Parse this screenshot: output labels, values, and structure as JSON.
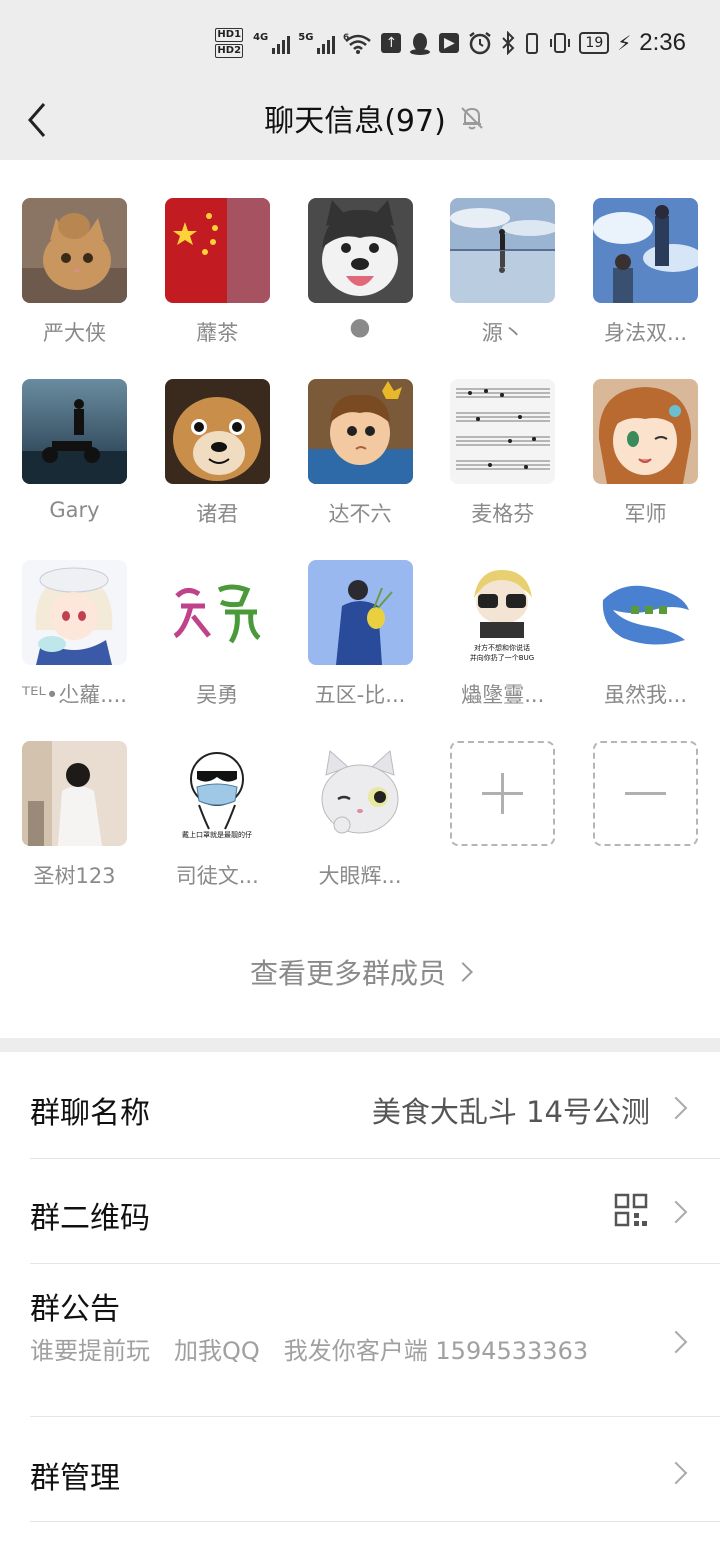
{
  "status_bar": {
    "hd1": "HD1",
    "hd2": "HD2",
    "network_4g": "4G",
    "network_5g": "5G",
    "wifi_tag": "6",
    "battery": "19",
    "time": "2:36",
    "icons": [
      "wifi-icon",
      "upload-icon",
      "qq-icon",
      "app-icon",
      "alarm-icon",
      "bluetooth-icon",
      "vibrate-icon",
      "battery-icon",
      "charging-icon"
    ]
  },
  "nav": {
    "title": "聊天信息(97)",
    "back_icon": "chevron-left-icon",
    "mute_icon": "bell-off-icon"
  },
  "members": [
    {
      "name": "严大侠",
      "avatar": "cat-photo"
    },
    {
      "name": "蘼茶",
      "avatar": "flag-photo"
    },
    {
      "name": "🌑",
      "avatar": "husky-photo"
    },
    {
      "name": "源丶",
      "avatar": "reflection-photo"
    },
    {
      "name": "身法双...",
      "avatar": "anime-sky"
    },
    {
      "name": "Gary",
      "avatar": "motorbike-photo"
    },
    {
      "name": "诸君",
      "avatar": "shiba-photo"
    },
    {
      "name": "达不六",
      "avatar": "cartoon-boy"
    },
    {
      "name": "麦格芬",
      "avatar": "sheet-music"
    },
    {
      "name": "军师",
      "avatar": "anime-girl"
    },
    {
      "name": "ᵀᴱᴸ•尐蘿....",
      "avatar": "anime-white-hair"
    },
    {
      "name": "吴勇",
      "avatar": "calligraphy"
    },
    {
      "name": "五区-比...",
      "avatar": "blue-robe"
    },
    {
      "name": "爞墬靊...",
      "avatar": "glasses-meme"
    },
    {
      "name": "虽然我...",
      "avatar": "blue-dragon"
    },
    {
      "name": "圣树123",
      "avatar": "man-back"
    },
    {
      "name": "司徒文...",
      "avatar": "mask-meme"
    },
    {
      "name": "大眼辉...",
      "avatar": "wink-cat"
    }
  ],
  "add_member_icon": "plus-icon",
  "remove_member_icon": "minus-icon",
  "more_members_label": "查看更多群成员",
  "settings": {
    "group_name": {
      "label": "群聊名称",
      "value": "美食大乱斗 14号公测"
    },
    "qr_code": {
      "label": "群二维码"
    },
    "notice": {
      "label": "群公告",
      "text": "谁要提前玩　加我QQ　我发你客户端 1594533363"
    },
    "manage": {
      "label": "群管理"
    }
  }
}
